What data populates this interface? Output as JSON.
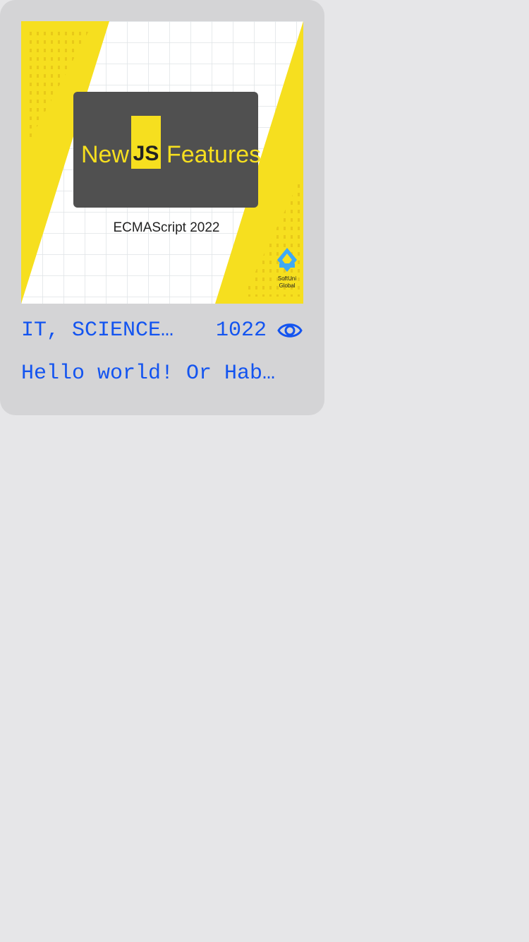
{
  "card": {
    "thumbnail": {
      "headline_left": "New",
      "headline_badge": "JS",
      "headline_right": "Features",
      "subtitle": "ECMAScript 2022",
      "logo_line1": "SoftUni",
      "logo_line2": "Global",
      "colors": {
        "accent": "#f6df1f",
        "panel": "#505050",
        "logo": "#3fa9f5"
      }
    },
    "category": "IT, SCIENCE…",
    "views": "1022",
    "view_icon": "eye-icon",
    "title": "Hello world! Or Hab…"
  }
}
